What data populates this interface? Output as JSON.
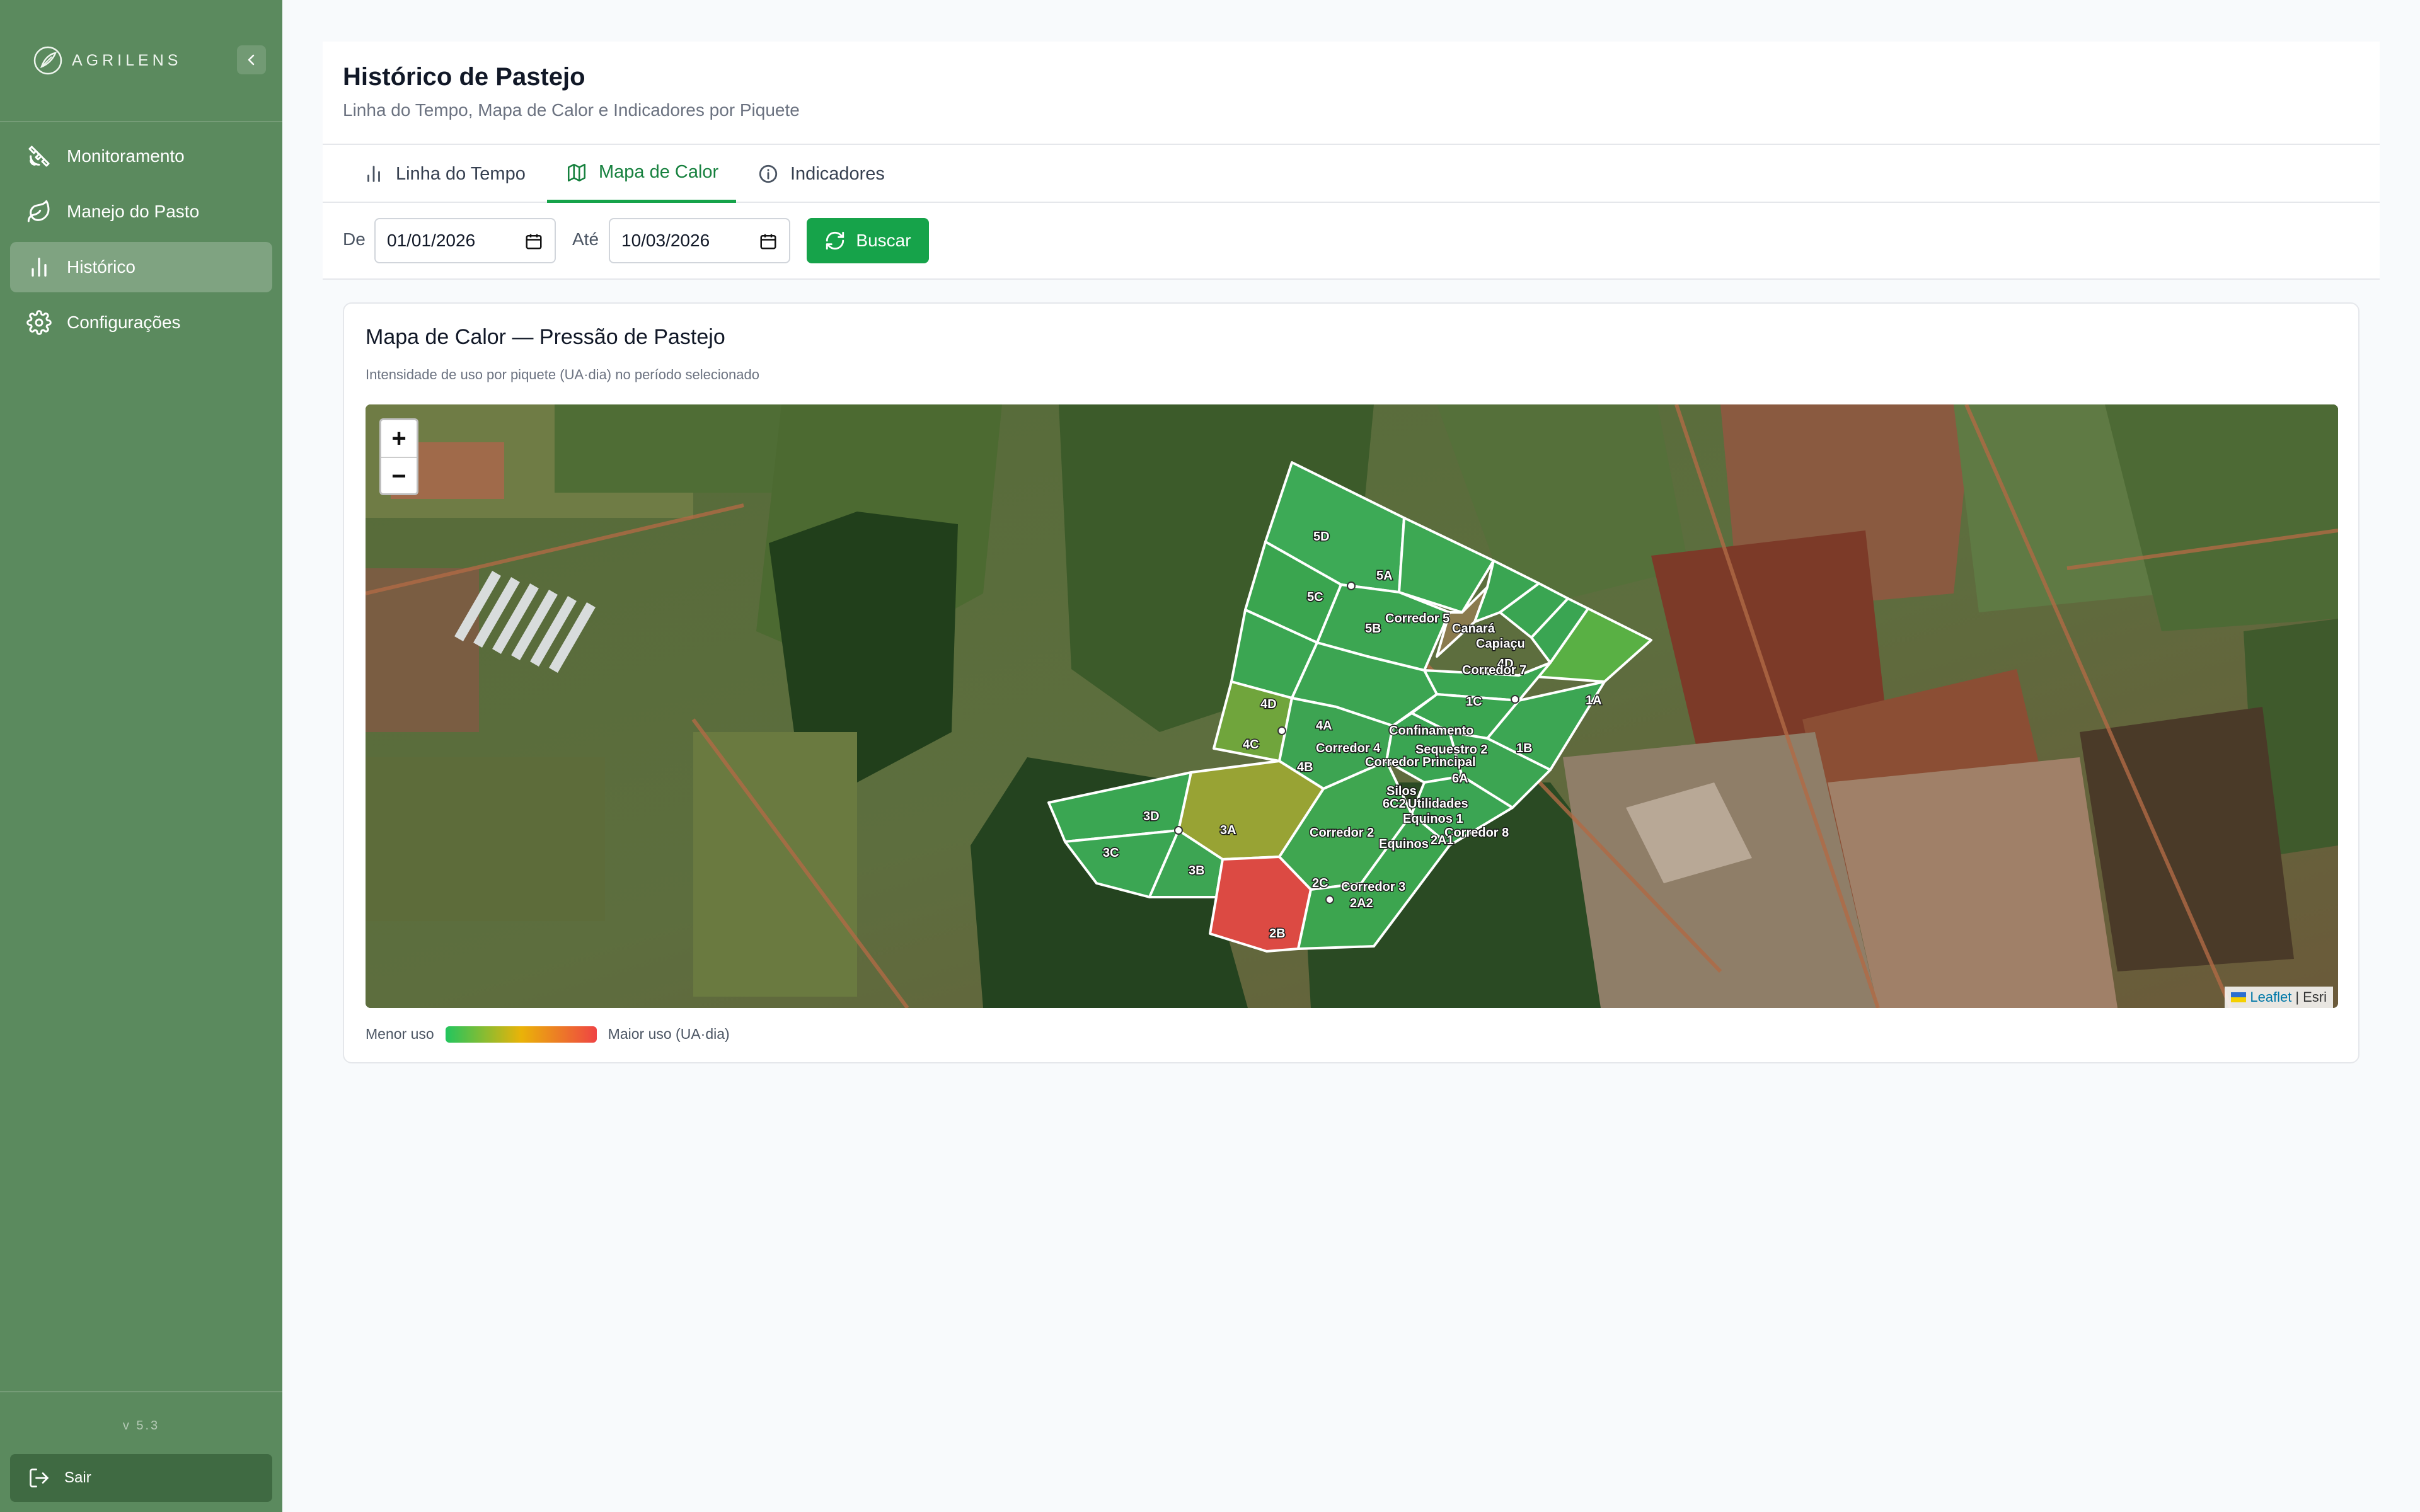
{
  "app": {
    "brand": "AGRILENS",
    "version": "v 5.3"
  },
  "colors": {
    "sidebar": "#5b8a5e",
    "accent": "#16a34a",
    "low_use": "#22c55e",
    "mid_use": "#eab308",
    "high_use": "#ef4444"
  },
  "sidebar": {
    "items": [
      {
        "label": "Monitoramento",
        "icon": "satellite-icon",
        "active": false
      },
      {
        "label": "Manejo do Pasto",
        "icon": "leaf-icon",
        "active": false
      },
      {
        "label": "Histórico",
        "icon": "bar-chart-icon",
        "active": true
      },
      {
        "label": "Configurações",
        "icon": "gear-icon",
        "active": false
      }
    ],
    "logout_label": "Sair"
  },
  "header": {
    "title": "Histórico de Pastejo",
    "subtitle": "Linha do Tempo, Mapa de Calor e Indicadores por Piquete"
  },
  "tabs": [
    {
      "label": "Linha do Tempo",
      "icon": "bar-chart-icon",
      "active": false
    },
    {
      "label": "Mapa de Calor",
      "icon": "map-icon",
      "active": true
    },
    {
      "label": "Indicadores",
      "icon": "info-icon",
      "active": false
    }
  ],
  "filters": {
    "from_label": "De",
    "from_value": "01/01/2026",
    "to_label": "Até",
    "to_value": "10/03/2026",
    "search_label": "Buscar"
  },
  "card": {
    "title": "Mapa de Calor — Pressão de Pastejo",
    "subtitle": "Intensidade de uso por piquete (UA·dia) no período selecionado",
    "legend_low": "Menor uso",
    "legend_high": "Maior uso (UA·dia)"
  },
  "map": {
    "zoom_in": "+",
    "zoom_out": "−",
    "attribution_leaflet": "Leaflet",
    "attribution_sep": "|",
    "attribution_esri": "Esri",
    "labels": {
      "p5D": "5D",
      "p5A": "5A",
      "p5C": "5C",
      "p5B": "5B",
      "corredor5": "Corredor 5",
      "canara": "Canará",
      "capiacu": "Capiaçu",
      "p4D_small": "4D",
      "corredor7": "Corredor 7",
      "p1A": "1A",
      "p4D": "4D",
      "p1C": "1C",
      "p4A": "4A",
      "p4C": "4C",
      "confinamento": "Confinamento",
      "corredor4": "Corredor 4",
      "sequestro2": "Sequestro 2",
      "p1B": "1B",
      "p4B": "4B",
      "corredor_principal": "Corredor Principal",
      "p6A": "6A",
      "silos": "Silos",
      "p6C2": "6C2",
      "utilidades": "Utilidades",
      "equinos1": "Equinos 1",
      "p3D": "3D",
      "p3A": "3A",
      "corredor2": "Corredor 2",
      "corredor8": "Corredor 8",
      "equinos": "Equinos",
      "p2A1": "2A1",
      "p3C": "3C",
      "p3B": "3B",
      "p2C": "2C",
      "corredor3": "Corredor 3",
      "p2A2": "2A2",
      "p2B": "2B"
    }
  }
}
